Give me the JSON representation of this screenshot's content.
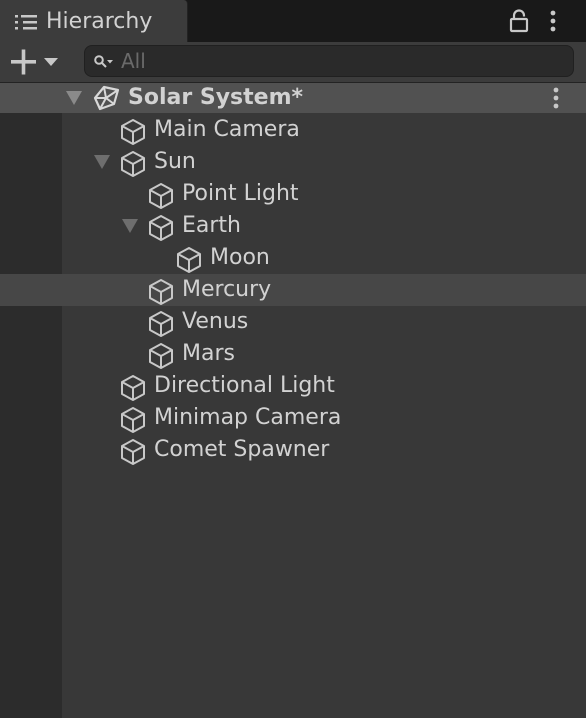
{
  "window": {
    "tab_title": "Hierarchy",
    "tab_icon": "hierarchy-list-icon",
    "lock_icon": "lock-icon",
    "menu_icon": "kebab-menu-icon"
  },
  "toolbar": {
    "add_icon": "plus-icon",
    "dropdown_icon": "chevron-down-icon",
    "search_icon": "search-icon",
    "search_placeholder": "All",
    "search_value": ""
  },
  "scene": {
    "name": "Solar System*",
    "icon": "unity-logo-icon",
    "expanded": true
  },
  "tree": {
    "items": [
      {
        "label": "Main Camera",
        "depth": 1,
        "has_children": false,
        "expanded": false,
        "selected": false,
        "icon": "cube-icon"
      },
      {
        "label": "Sun",
        "depth": 1,
        "has_children": true,
        "expanded": true,
        "selected": false,
        "icon": "cube-icon"
      },
      {
        "label": "Point Light",
        "depth": 2,
        "has_children": false,
        "expanded": false,
        "selected": false,
        "icon": "cube-icon"
      },
      {
        "label": "Earth",
        "depth": 2,
        "has_children": true,
        "expanded": true,
        "selected": false,
        "icon": "cube-icon"
      },
      {
        "label": "Moon",
        "depth": 3,
        "has_children": false,
        "expanded": false,
        "selected": false,
        "icon": "cube-icon"
      },
      {
        "label": "Mercury",
        "depth": 2,
        "has_children": false,
        "expanded": false,
        "selected": true,
        "icon": "cube-icon"
      },
      {
        "label": "Venus",
        "depth": 2,
        "has_children": false,
        "expanded": false,
        "selected": false,
        "icon": "cube-icon"
      },
      {
        "label": "Mars",
        "depth": 2,
        "has_children": false,
        "expanded": false,
        "selected": false,
        "icon": "cube-icon"
      },
      {
        "label": "Directional Light",
        "depth": 1,
        "has_children": false,
        "expanded": false,
        "selected": false,
        "icon": "cube-icon"
      },
      {
        "label": "Minimap Camera",
        "depth": 1,
        "has_children": false,
        "expanded": false,
        "selected": false,
        "icon": "cube-icon"
      },
      {
        "label": "Comet Spawner",
        "depth": 1,
        "has_children": false,
        "expanded": false,
        "selected": false,
        "icon": "cube-icon"
      }
    ]
  },
  "colors": {
    "background": "#191919",
    "tab": "#3c3c3c",
    "tree_background": "#383838",
    "gutter": "#2c2c2c",
    "scene_header": "#515151",
    "selected_row": "#474747",
    "text": "#d2d2d2",
    "icon": "#c8c8c8"
  }
}
